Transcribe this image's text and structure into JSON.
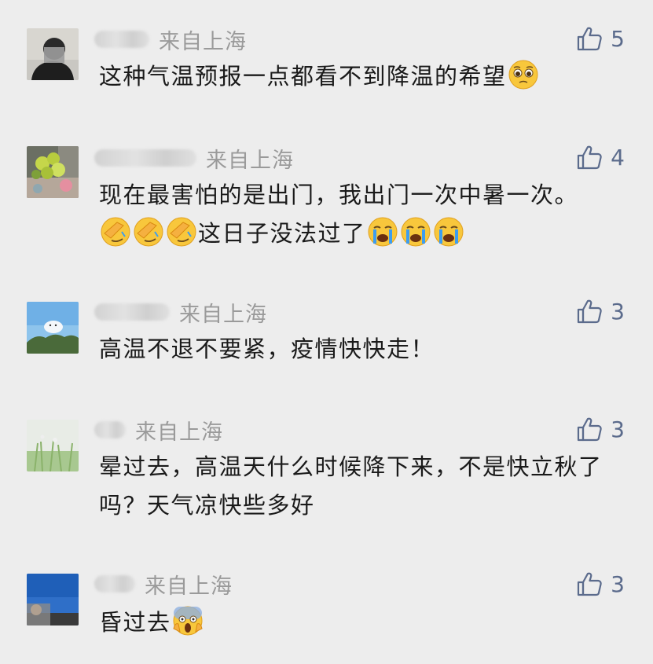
{
  "comments": [
    {
      "location": "来自上海",
      "likes": "5",
      "text": "这种气温预报一点都看不到降温的希望",
      "emojis": [
        "pleading-face"
      ]
    },
    {
      "location": "来自上海",
      "likes": "4",
      "text_a": "现在最害怕的是出门，我出门一次中暑一次。",
      "text_b": "这日子没法过了",
      "emojis": [
        "face-palm",
        "face-palm",
        "face-palm",
        "crying-face",
        "crying-face",
        "crying-face"
      ]
    },
    {
      "location": "来自上海",
      "likes": "3",
      "text": "高温不退不要紧，疫情快快走！"
    },
    {
      "location": "来自上海",
      "likes": "3",
      "text": "晕过去，高温天什么时候降下来，不是快立秋了吗？天气凉快些多好"
    },
    {
      "location": "来自上海",
      "likes": "3",
      "text": "昏过去",
      "emojis": [
        "screaming-face"
      ]
    }
  ],
  "colors": {
    "background": "#ededed",
    "location": "#9a9a9a",
    "like": "#5b6b8c",
    "text": "#1a1a1a"
  }
}
